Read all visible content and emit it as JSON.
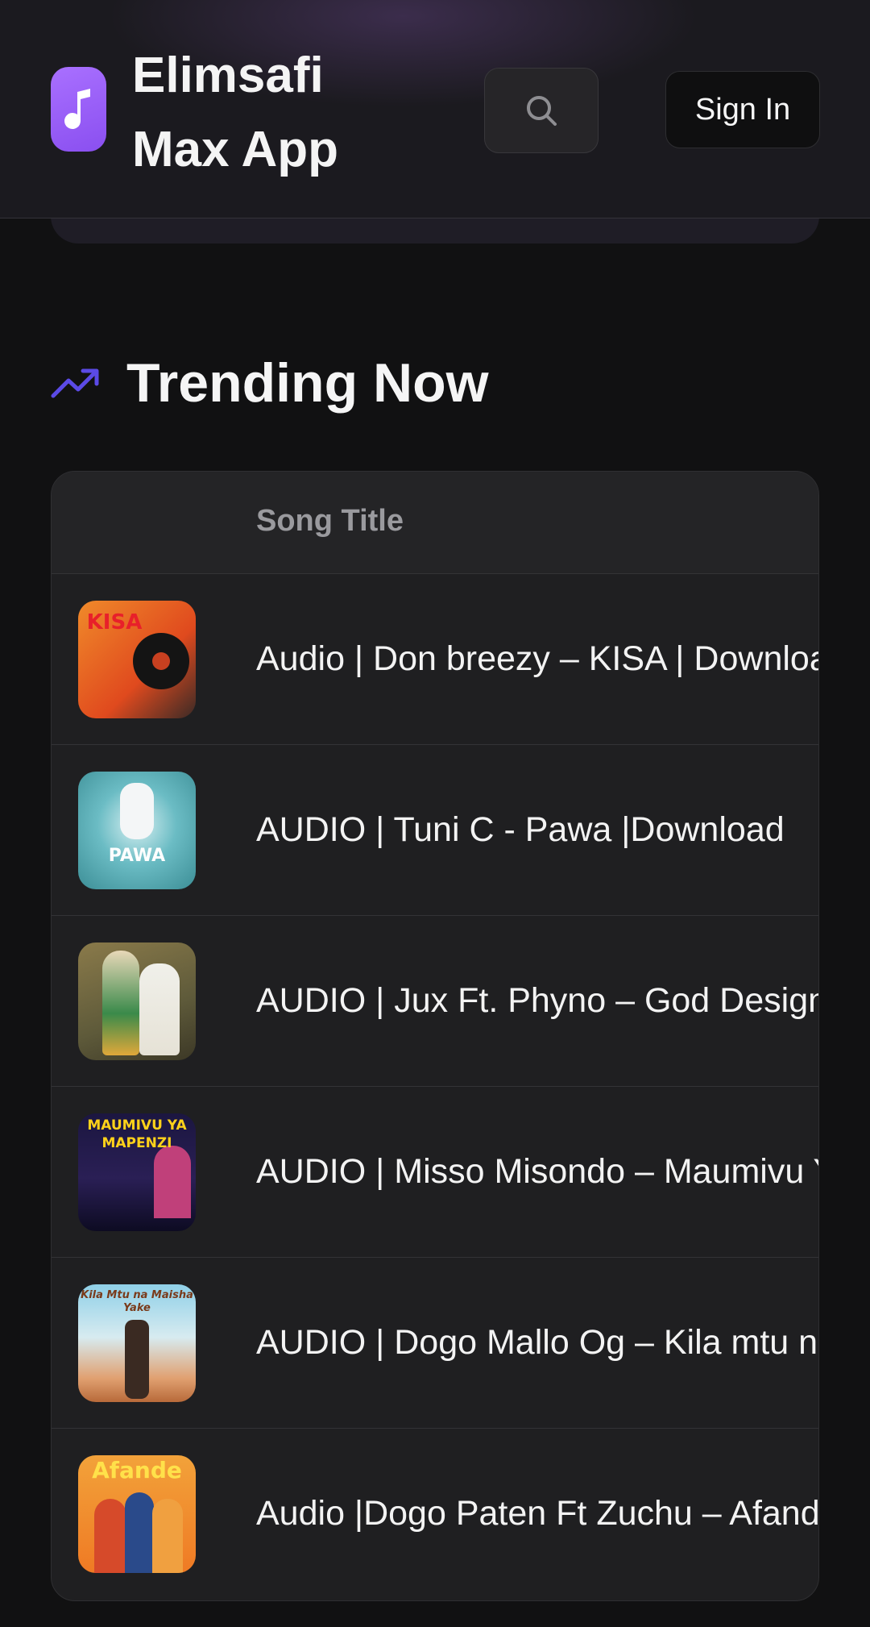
{
  "header": {
    "app_title": "Elimsafi Max App",
    "logo_icon": "music-note-icon",
    "search_icon": "search-icon",
    "sign_in_label": "Sign In",
    "accent_color": "#9b5ff8"
  },
  "trending": {
    "title": "Trending Now",
    "icon": "trending-up-icon",
    "icon_color": "#5b4ae6",
    "column_header": "Song Title",
    "songs": [
      {
        "title": "Audio | Don breezy – KISA | Download",
        "cover_text": "KISA"
      },
      {
        "title": "AUDIO | Tuni C - Pawa |Download",
        "cover_text": "PAWA"
      },
      {
        "title": "AUDIO | Jux Ft. Phyno – God Design",
        "cover_text": ""
      },
      {
        "title": "AUDIO | Misso Misondo – Maumivu Ya Mapenzi",
        "cover_text": "MAUMIVU YA MAPENZI"
      },
      {
        "title": "AUDIO | Dogo Mallo Og – Kila mtu na Maisha Yake",
        "cover_text": "Kila Mtu na Maisha Yake"
      },
      {
        "title": "Audio |Dogo Paten Ft Zuchu – Afande",
        "cover_text": "Afande"
      }
    ]
  }
}
